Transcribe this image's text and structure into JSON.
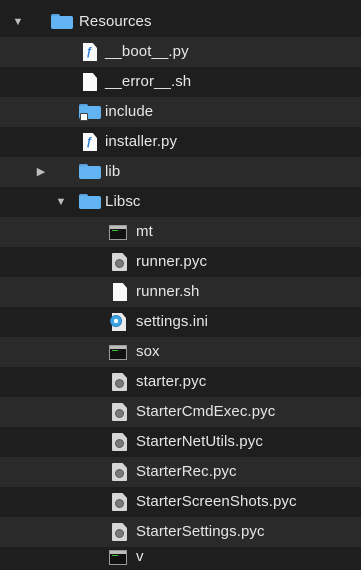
{
  "colors": {
    "background": "#1e1e1e",
    "row_alt": "#2a2a2a",
    "text": "#e6e6e6",
    "folder": "#62b3f2"
  },
  "rows": [
    {
      "label": "Resources",
      "icon": "folder-icon",
      "disclosure": "expanded"
    },
    {
      "label": "__boot__.py",
      "icon": "python-file-icon"
    },
    {
      "label": "__error__.sh",
      "icon": "document-icon"
    },
    {
      "label": "include",
      "icon": "folder-alias-icon"
    },
    {
      "label": "installer.py",
      "icon": "python-file-icon"
    },
    {
      "label": "lib",
      "icon": "folder-icon",
      "disclosure": "collapsed"
    },
    {
      "label": "Libsc",
      "icon": "folder-icon",
      "disclosure": "expanded"
    },
    {
      "label": "mt",
      "icon": "executable-icon"
    },
    {
      "label": "runner.pyc",
      "icon": "pyc-file-icon"
    },
    {
      "label": "runner.sh",
      "icon": "document-icon"
    },
    {
      "label": "settings.ini",
      "icon": "settings-file-icon"
    },
    {
      "label": "sox",
      "icon": "executable-icon"
    },
    {
      "label": "starter.pyc",
      "icon": "pyc-file-icon"
    },
    {
      "label": "StarterCmdExec.pyc",
      "icon": "pyc-file-icon"
    },
    {
      "label": "StarterNetUtils.pyc",
      "icon": "pyc-file-icon"
    },
    {
      "label": "StarterRec.pyc",
      "icon": "pyc-file-icon"
    },
    {
      "label": "StarterScreenShots.pyc",
      "icon": "pyc-file-icon"
    },
    {
      "label": "StarterSettings.pyc",
      "icon": "pyc-file-icon"
    },
    {
      "label": "v",
      "icon": "executable-icon"
    }
  ]
}
